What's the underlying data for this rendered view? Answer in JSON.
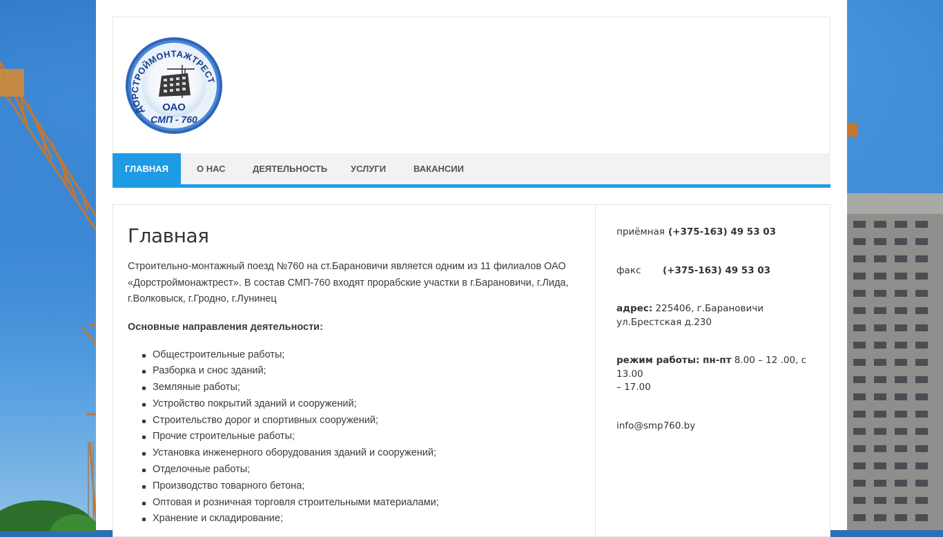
{
  "logo": {
    "ring_text": "ДОРСТРОЙМОНТАЖТРЕСТ",
    "org_type": "ОАО",
    "org_name": "СМП - 760"
  },
  "nav": {
    "items": [
      {
        "label": "Главная",
        "active": true
      },
      {
        "label": "О нас",
        "active": false
      },
      {
        "label": "Деятельность",
        "active": false
      },
      {
        "label": "Услуги",
        "active": false
      },
      {
        "label": "Вакансии",
        "active": false
      }
    ]
  },
  "main": {
    "title": "Главная",
    "intro_line1": "Строительно-монтажный поезд №760 на ст.Барановичи является одним из 11 филиалов ОАО",
    "intro_line2": "«Дорстроймонажтрест». В состав СМП-760 входят прорабские участки в г.Барановичи, г.Лида,",
    "intro_line3": "г.Волковыск, г.Гродно, г.Лунинец",
    "section_heading": "Основные направления деятельности:",
    "activities": [
      "Общестроительные работы;",
      "Разборка и снос зданий;",
      "Земляные работы;",
      "Устройство покрытий зданий и сооружений;",
      "Строительство дорог и спортивных сооружений;",
      "Прочие строительные работы;",
      "Установка инженерного оборудования зданий и сооружений;",
      "Отделочные работы;",
      "Производство товарного бетона;",
      "Оптовая и розничная торговля строительными материалами;",
      "Хранение и складирование;"
    ]
  },
  "sidebar": {
    "reception_label": "приёмная",
    "reception_phone": "(+375-163) 49 53 03",
    "fax_label": "факс",
    "fax_phone": "(+375-163) 49 53 03",
    "address_label": "адрес:",
    "address_line1": "225406, г.Барановичи",
    "address_line2": "ул.Брестская д.230",
    "hours_label": "режим работы: пн-пт",
    "hours_line1": "8.00 – 12 .00, с 13.00",
    "hours_line2": "– 17.00",
    "email": "info@smp760.by"
  },
  "colors": {
    "accent": "#1e9be5",
    "logo_blue": "#1a4f9f",
    "nav_bg": "#f2f2f2"
  }
}
